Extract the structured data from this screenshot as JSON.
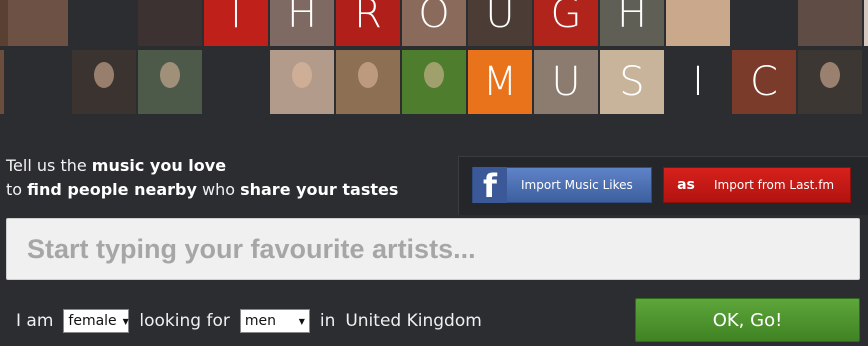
{
  "header": {
    "row1_letters": [
      "T",
      "H",
      "R",
      "O",
      "U",
      "G",
      "H"
    ],
    "row2_letters": [
      "M",
      "U",
      "S",
      "I",
      "C"
    ]
  },
  "intro": {
    "line1_prefix": "Tell us the ",
    "line1_bold": "music you love",
    "line2_prefix": "to ",
    "line2_bold1": "find people nearby",
    "line2_mid": " who ",
    "line2_bold2": "share your tastes"
  },
  "import": {
    "facebook_label": "Import Music Likes",
    "facebook_icon": "f",
    "lastfm_label": "Import from Last.fm",
    "lastfm_icon": "as"
  },
  "search": {
    "placeholder": "Start typing your favourite artists..."
  },
  "filters": {
    "i_am": "I am",
    "gender_value": "female",
    "looking_for": "looking for",
    "seeking_value": "men",
    "in": "in",
    "location": "United Kingdom"
  },
  "submit": {
    "label": "OK, Go!"
  },
  "colors": {
    "orange_tile": "#e8731a",
    "facebook_blue": "#4a6db5",
    "lastfm_red": "#c81a16",
    "go_green": "#4c922c"
  }
}
